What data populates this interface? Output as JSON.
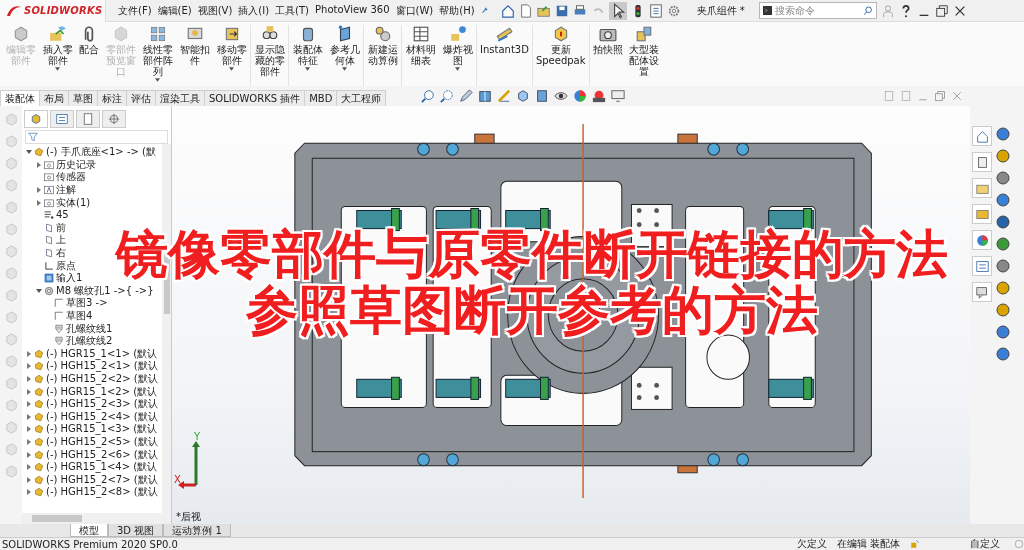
{
  "app": {
    "brand": "SOLIDWORKS",
    "document_title": "夹爪组件 *"
  },
  "menu": [
    "文件(F)",
    "编辑(E)",
    "视图(V)",
    "插入(I)",
    "工具(T)",
    "PhotoView 360",
    "窗口(W)",
    "帮助(H)"
  ],
  "search": {
    "placeholder": "搜索命令"
  },
  "ribbon": [
    {
      "label": "编辑零部件",
      "disabled": true,
      "dropdown": false
    },
    {
      "label": "插入零部件",
      "disabled": false,
      "dropdown": true
    },
    {
      "label": "配合",
      "disabled": false,
      "dropdown": false
    },
    {
      "label": "零部件预览窗口",
      "disabled": true,
      "dropdown": false
    },
    {
      "label": "线性零部件阵列",
      "disabled": false,
      "dropdown": true
    },
    {
      "label": "智能扣件",
      "disabled": false,
      "dropdown": false
    },
    {
      "label": "移动零部件",
      "disabled": false,
      "dropdown": true
    },
    {
      "label": "显示隐藏的零部件",
      "disabled": false,
      "dropdown": false
    },
    {
      "label": "装配体特征",
      "disabled": false,
      "dropdown": true
    },
    {
      "label": "参考几何体",
      "disabled": false,
      "dropdown": true
    },
    {
      "label": "新建运动算例",
      "disabled": false,
      "dropdown": false
    },
    {
      "label": "材料明细表",
      "disabled": false,
      "dropdown": false
    },
    {
      "label": "爆炸视图",
      "disabled": false,
      "dropdown": true
    },
    {
      "label": "Instant3D",
      "disabled": false,
      "dropdown": false
    },
    {
      "label": "更新Speedpak",
      "disabled": false,
      "dropdown": false
    },
    {
      "label": "拍快照",
      "disabled": false,
      "dropdown": false
    },
    {
      "label": "大型装配体设置",
      "disabled": false,
      "dropdown": false
    }
  ],
  "tabs": [
    {
      "label": "装配体",
      "selected": true
    },
    {
      "label": "布局",
      "selected": false
    },
    {
      "label": "草图",
      "selected": false
    },
    {
      "label": "标注",
      "selected": false
    },
    {
      "label": "评估",
      "selected": false
    },
    {
      "label": "渲染工具",
      "selected": false
    },
    {
      "label": "SOLIDWORKS 插件",
      "selected": false
    },
    {
      "label": "MBD",
      "selected": false
    },
    {
      "label": "大工程师",
      "selected": false
    }
  ],
  "tree": [
    {
      "kind": "part",
      "label": "(-) 手爪底座<1> -> (默",
      "expanded": true,
      "children": [
        {
          "kind": "folder",
          "label": "历史记录",
          "expanded": false
        },
        {
          "kind": "folder",
          "label": "传感器"
        },
        {
          "kind": "annotation",
          "label": "注解",
          "expanded": false
        },
        {
          "kind": "folder",
          "label": "实体(1)",
          "expanded": false
        },
        {
          "kind": "material",
          "label": "45"
        },
        {
          "kind": "plane",
          "label": "前"
        },
        {
          "kind": "plane",
          "label": "上"
        },
        {
          "kind": "plane",
          "label": "右"
        },
        {
          "kind": "origin",
          "label": "原点"
        },
        {
          "kind": "import",
          "label": "输入1"
        },
        {
          "kind": "hole",
          "label": "M8 螺纹孔1 ->{ ->}",
          "expanded": true,
          "children": [
            {
              "kind": "sketch",
              "label": "草图3 ->"
            },
            {
              "kind": "sketch",
              "label": "草图4"
            },
            {
              "kind": "thread",
              "label": "孔螺纹线1"
            },
            {
              "kind": "thread",
              "label": "孔螺纹线2"
            }
          ]
        }
      ]
    },
    {
      "kind": "part",
      "label": "(-) HGR15_1<1> (默认",
      "expanded": false
    },
    {
      "kind": "part",
      "label": "(-) HGH15_2<1> (默认",
      "expanded": false
    },
    {
      "kind": "part",
      "label": "(-) HGH15_2<2> (默认",
      "expanded": false
    },
    {
      "kind": "part",
      "label": "(-) HGR15_1<2> (默认",
      "expanded": false
    },
    {
      "kind": "part",
      "label": "(-) HGH15_2<3> (默认",
      "expanded": false
    },
    {
      "kind": "part",
      "label": "(-) HGH15_2<4> (默认",
      "expanded": false
    },
    {
      "kind": "part",
      "label": "(-) HGR15_1<3> (默认",
      "expanded": false
    },
    {
      "kind": "part",
      "label": "(-) HGH15_2<5> (默认",
      "expanded": false
    },
    {
      "kind": "part",
      "label": "(-) HGH15_2<6> (默认",
      "expanded": false
    },
    {
      "kind": "part",
      "label": "(-) HGR15_1<4> (默认",
      "expanded": false
    },
    {
      "kind": "part",
      "label": "(-) HGH15_2<7> (默认",
      "expanded": false
    },
    {
      "kind": "part",
      "label": "(-) HGH15_2<8> (默认",
      "expanded": false
    }
  ],
  "viewport": {
    "view_name": "*后视",
    "axis_labels": [
      "Y",
      "X"
    ]
  },
  "caption": [
    "镜像零部件与原零件断开链接的方法",
    "参照草图断开参考的方法"
  ],
  "bottom_tabs": [
    {
      "label": "模型",
      "selected": true
    },
    {
      "label": "3D 视图",
      "selected": false
    },
    {
      "label": "运动算例 1",
      "selected": false
    }
  ],
  "status_bar": {
    "product": "SOLIDWORKS Premium 2020 SP0.0",
    "items": [
      "欠定义",
      "在编辑 装配体"
    ],
    "units": "自定义"
  }
}
